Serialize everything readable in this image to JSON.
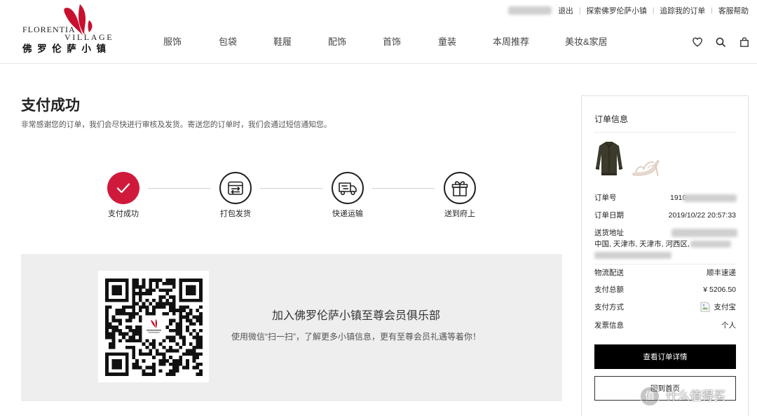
{
  "header": {
    "logo": {
      "line1": "FLORENTIA",
      "line2": "VILLAGE",
      "cn": "佛罗伦萨小镇"
    },
    "top_links": {
      "logout": "退出",
      "explore": "探索佛罗伦萨小镇",
      "track": "追踪我的订单",
      "help": "客服帮助",
      "separator": "|"
    },
    "nav": [
      {
        "label": "服饰"
      },
      {
        "label": "包袋"
      },
      {
        "label": "鞋履"
      },
      {
        "label": "配饰"
      },
      {
        "label": "首饰"
      },
      {
        "label": "童装"
      },
      {
        "label": "本周推荐"
      },
      {
        "label": "美妆&家居"
      }
    ],
    "icons": [
      "heart-icon",
      "search-icon",
      "bag-icon"
    ]
  },
  "main": {
    "title": "支付成功",
    "subtitle": "非常感谢您的订单，我们会尽快进行审核及发货。寄送您的订单时，我们会通过短信通知您。",
    "steps": [
      {
        "label": "支付成功",
        "icon": "check-icon",
        "done": true
      },
      {
        "label": "打包发货",
        "icon": "package-icon",
        "done": false
      },
      {
        "label": "快递运输",
        "icon": "truck-icon",
        "done": false
      },
      {
        "label": "送到府上",
        "icon": "gift-icon",
        "done": false
      }
    ],
    "promo": {
      "title": "加入佛罗伦萨小镇至尊会员俱乐部",
      "text": "使用微信“扫一扫”，了解更多小镇信息，更有至尊会员礼遇等着你！",
      "qr_icon": "qr-code-image"
    }
  },
  "order": {
    "title": "订单信息",
    "products": [
      "jacket-image",
      "sandal-image"
    ],
    "number": {
      "label": "订单号",
      "value": "1910"
    },
    "date": {
      "label": "订单日期",
      "value": "2019/10/22 20:57:33"
    },
    "address": {
      "label": "送货地址",
      "line": "中国, 天津市, 天津市, 河西区,"
    },
    "shipping": {
      "label": "物流配送",
      "value": "顺丰速递"
    },
    "total": {
      "label": "支付总额",
      "value": "¥ 5206.50"
    },
    "payment": {
      "label": "支付方式",
      "value": "支付宝",
      "icon": "broken-image-icon"
    },
    "invoice": {
      "label": "发票信息",
      "value": "个人"
    },
    "details_button": "查看订单详情",
    "home_button": "回到首页"
  },
  "watermark": {
    "badge": "值",
    "text": "什么值得买"
  },
  "colors": {
    "accent": "#d01a3c",
    "logo_red": "#c8102e",
    "text": "#222222",
    "muted": "#555555",
    "promo_bg": "#eeeeee",
    "border": "#e2e2e2",
    "button_bg": "#000000"
  }
}
